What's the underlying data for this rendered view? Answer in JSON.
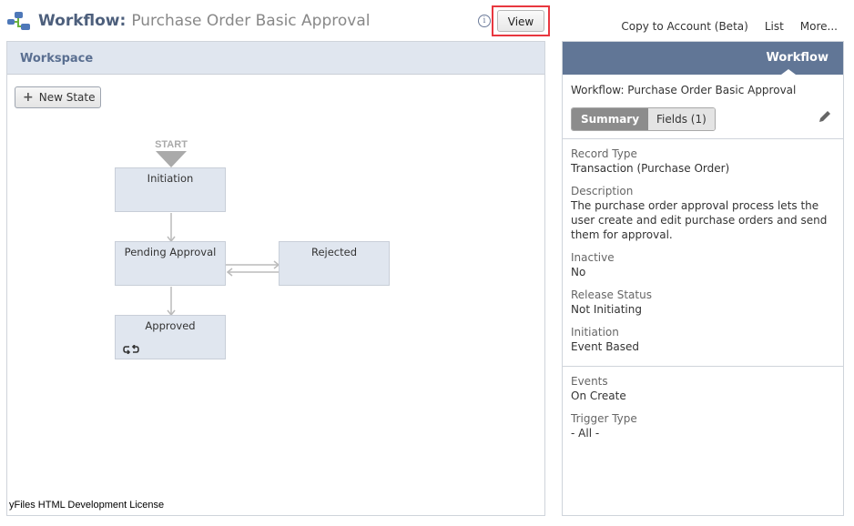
{
  "header": {
    "title_prefix": "Workflow:",
    "title_name": "Purchase Order Basic Approval",
    "info_icon": "i",
    "view_button": "View",
    "links": [
      "Copy to Account (Beta)",
      "List",
      "More..."
    ]
  },
  "workspace": {
    "title": "Workspace",
    "new_state_button": "New State",
    "start_label": "START",
    "states": [
      "Initiation",
      "Pending Approval",
      "Rejected",
      "Approved"
    ],
    "license_text": "yFiles HTML Development License"
  },
  "panel": {
    "header_label": "Workflow",
    "workflow_title": "Workflow: Purchase Order Basic Approval",
    "tabs": [
      "Summary",
      "Fields (1)"
    ],
    "fields": [
      {
        "label": "Record Type",
        "value": "Transaction (Purchase Order)"
      },
      {
        "label": "Description",
        "value": "The purchase order approval process lets the user create and edit purchase orders and send them for approval."
      },
      {
        "label": "Inactive",
        "value": "No"
      },
      {
        "label": "Release Status",
        "value": "Not Initiating"
      },
      {
        "label": "Initiation",
        "value": "Event Based"
      }
    ],
    "trigger_fields": [
      {
        "label": "Events",
        "value": "On Create"
      },
      {
        "label": "Trigger Type",
        "value": "- All -"
      }
    ]
  },
  "colors": {
    "accent_header": "#617696",
    "workspace_header": "#e0e6ef",
    "highlight": "#e8373f",
    "node_fill": "#e0e6ef"
  }
}
